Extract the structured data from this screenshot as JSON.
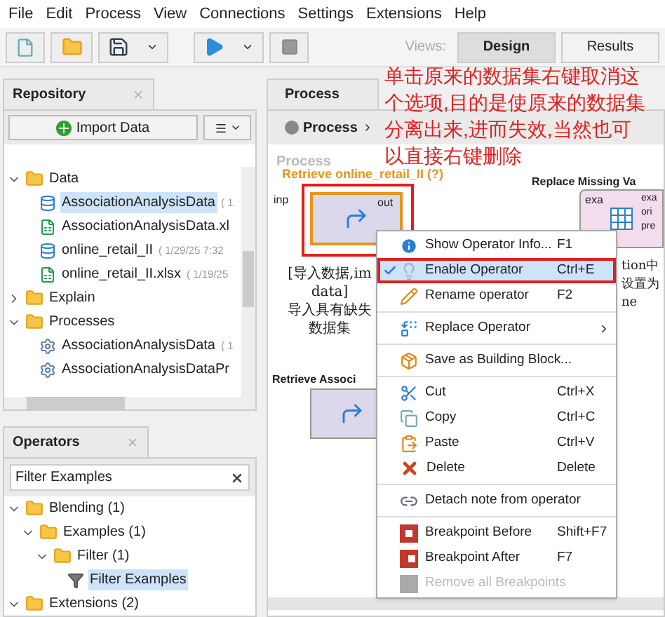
{
  "menu_bar": [
    {
      "label": "File"
    },
    {
      "label": "Edit"
    },
    {
      "label": "Process"
    },
    {
      "label": "View"
    },
    {
      "label": "Connections"
    },
    {
      "label": "Settings"
    },
    {
      "label": "Extensions"
    },
    {
      "label": "Help"
    }
  ],
  "views": {
    "label": "Views:",
    "tabs": [
      {
        "label": "Design",
        "selected": true
      },
      {
        "label": "Results",
        "selected": false
      }
    ]
  },
  "repository": {
    "title": "Repository",
    "import_button": "Import Data",
    "tree": [
      {
        "label": "Data",
        "kind": "folder",
        "expanded": true,
        "children": [
          {
            "label": "AssociationAnalysisData",
            "meta": "( 1",
            "kind": "data",
            "selected": true
          },
          {
            "label": "AssociationAnalysisData.xl",
            "kind": "excel",
            "selected": false
          },
          {
            "label": "online_retail_II",
            "meta": "( 1/29/25 7:32",
            "kind": "data",
            "selected": false
          },
          {
            "label": "online_retail_II.xlsx",
            "meta": "( 1/19/25",
            "kind": "excel",
            "selected": false
          }
        ]
      },
      {
        "label": "Explain",
        "kind": "folder",
        "expanded": false
      },
      {
        "label": "Processes",
        "kind": "folder",
        "expanded": true,
        "children": [
          {
            "label": "AssociationAnalysisData",
            "meta": "( 1",
            "kind": "process",
            "selected": false
          },
          {
            "label": "AssociationAnalysisDataPr",
            "kind": "process",
            "selected": false
          }
        ]
      }
    ]
  },
  "operators": {
    "title": "Operators",
    "search": {
      "value": "Filter Examples"
    },
    "tree": [
      {
        "label": "Blending (1)",
        "kind": "folder",
        "expanded": true,
        "children": [
          {
            "label": "Examples (1)",
            "kind": "folder",
            "expanded": true,
            "children": [
              {
                "label": "Filter (1)",
                "kind": "folder",
                "expanded": true,
                "children": [
                  {
                    "label": "Filter Examples",
                    "kind": "operator",
                    "selected": true
                  }
                ]
              }
            ]
          }
        ]
      },
      {
        "label": "Extensions (2)",
        "kind": "folder",
        "expanded": true
      }
    ]
  },
  "process": {
    "title": "Process",
    "breadcrumb": "Process",
    "canvas_label": "Process",
    "annotation": [
      "单击原来的数据集右键取消这",
      "个选项,目的是使原来的数据集",
      "分离出来,进而失效,当然也可",
      "以直接右键删除"
    ],
    "operators": [
      {
        "title": "Retrieve online_retail_II (?)",
        "in_port": "inp",
        "out_port": "out",
        "kind": "retrieve",
        "highlighted": true,
        "note": [
          "[导入数据,im",
          "data]",
          "导入具有缺失",
          "数据集"
        ]
      },
      {
        "title": "Replace Missing Va",
        "in_port": "exa",
        "ports": [
          "exa",
          "ori",
          "pre"
        ],
        "kind": "replace",
        "highlighted": false,
        "note": [
          "tion中",
          "设置为",
          "ne"
        ]
      },
      {
        "title": "Retrieve Associ",
        "kind": "retrieve",
        "highlighted": false
      }
    ]
  },
  "context_menu": [
    {
      "kind": "item",
      "label": "Show Operator Info...",
      "shortcut": "F1",
      "checked": false,
      "highlighted": false,
      "disabled": false
    },
    {
      "kind": "item",
      "label": "Enable Operator",
      "shortcut": "Ctrl+E",
      "checked": true,
      "highlighted": true,
      "disabled": false
    },
    {
      "kind": "item",
      "label": "Rename operator",
      "shortcut": "F2",
      "checked": false,
      "highlighted": false,
      "disabled": false
    },
    {
      "kind": "separator"
    },
    {
      "kind": "submenu",
      "label": "Replace Operator",
      "checked": false,
      "highlighted": false,
      "disabled": false
    },
    {
      "kind": "separator"
    },
    {
      "kind": "item",
      "label": "Save as Building Block...",
      "checked": false,
      "highlighted": false,
      "disabled": false
    },
    {
      "kind": "separator"
    },
    {
      "kind": "item",
      "label": "Cut",
      "shortcut": "Ctrl+X",
      "checked": false,
      "highlighted": false,
      "disabled": false
    },
    {
      "kind": "item",
      "label": "Copy",
      "shortcut": "Ctrl+C",
      "checked": false,
      "highlighted": false,
      "disabled": false
    },
    {
      "kind": "item",
      "label": "Paste",
      "shortcut": "Ctrl+V",
      "checked": false,
      "highlighted": false,
      "disabled": false
    },
    {
      "kind": "item",
      "label": "Delete",
      "shortcut": "Delete",
      "checked": false,
      "highlighted": false,
      "disabled": false
    },
    {
      "kind": "separator"
    },
    {
      "kind": "item",
      "label": "Detach note from operator",
      "checked": false,
      "highlighted": false,
      "disabled": false
    },
    {
      "kind": "separator"
    },
    {
      "kind": "item",
      "label": "Breakpoint Before",
      "shortcut": "Shift+F7",
      "checked": false,
      "highlighted": false,
      "disabled": false
    },
    {
      "kind": "item",
      "label": "Breakpoint After",
      "shortcut": "F7",
      "checked": false,
      "highlighted": false,
      "disabled": false
    },
    {
      "kind": "item",
      "label": "Remove all Breakpoints",
      "checked": false,
      "highlighted": false,
      "disabled": true
    }
  ]
}
